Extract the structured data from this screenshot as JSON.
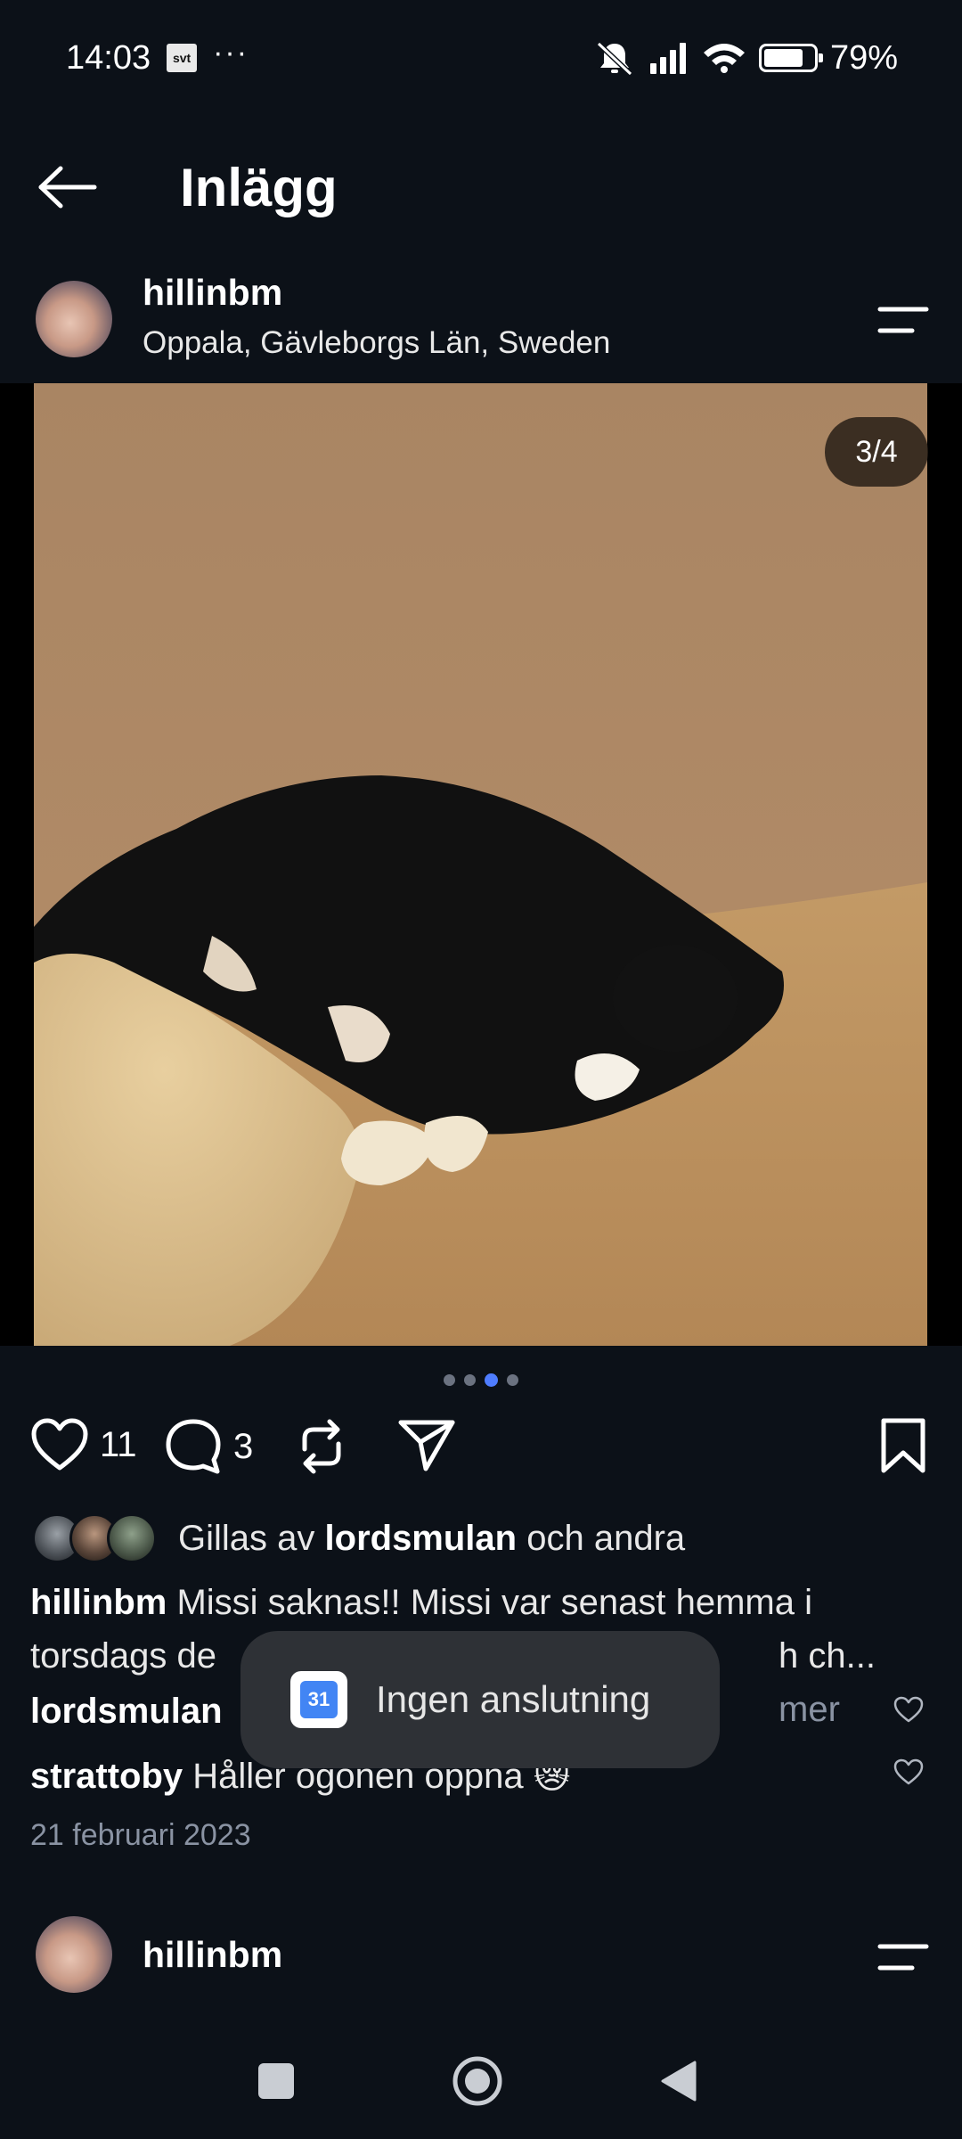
{
  "status_bar": {
    "time": "14:03",
    "app_badge": "svt",
    "more": "···",
    "battery": "79%",
    "battery_level": 0.79
  },
  "app_bar": {
    "title": "Inlägg"
  },
  "post": {
    "username": "hillinbm",
    "location": "Oppala, Gävleborgs Län, Sweden",
    "image_counter": "3/4",
    "carousel": {
      "total": 4,
      "active_index": 2
    },
    "likes_count": "11",
    "comments_count": "3",
    "liked_by": {
      "prefix": "Gillas av",
      "user": "lordsmulan",
      "suffix": "och andra"
    },
    "caption": {
      "user": "hillinbm",
      "line1": "Missi saknas!! Missi var senast hemma i",
      "line2": "torsdags de",
      "line2_end": "h ch...",
      "more": "mer"
    },
    "comments": [
      {
        "user": "lordsmulan",
        "text": ""
      },
      {
        "user": "strattoby",
        "text": "Håller ögonen öppna 😿"
      }
    ],
    "date": "21 februari 2023"
  },
  "next_post": {
    "username": "hillinbm"
  },
  "toast": {
    "icon_text": "31",
    "text": "Ingen anslutning"
  },
  "colors": {
    "background": "#0c1118",
    "accent": "#4f7dff",
    "muted": "#8a93a3",
    "toast_bg": "#2e3136"
  }
}
